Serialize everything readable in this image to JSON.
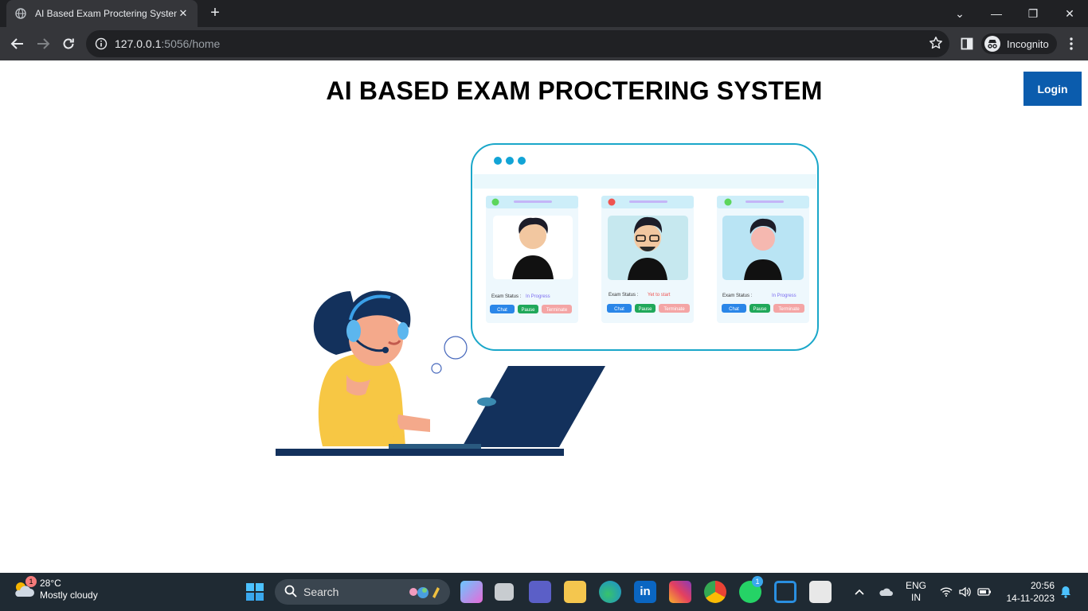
{
  "browser": {
    "tab_title": "AI Based Exam Proctering System",
    "tab_close": "✕",
    "new_tab": "+",
    "url_host": "127.0.0.1",
    "url_path": ":5056/home",
    "profile_label": "Incognito",
    "window_controls": [
      "⌄",
      "—",
      "❐",
      "✕"
    ]
  },
  "page": {
    "title": "AI BASED EXAM PROCTERING SYSTEM",
    "login_label": "Login"
  },
  "illustration": {
    "cards": [
      {
        "status_label": "Exam Status :",
        "status_value": "In Progress",
        "status_color": "#7b6cf0",
        "dot_color": "#5cd65c"
      },
      {
        "status_label": "Exam Status :",
        "status_value": "Yet to start",
        "status_color": "#ef5350",
        "dot_color": "#ef5350"
      },
      {
        "status_label": "Exam Status :",
        "status_value": "In Progress",
        "status_color": "#7b6cf0",
        "dot_color": "#5cd65c"
      }
    ],
    "buttons": [
      "Chat",
      "Pause",
      "Terminate"
    ]
  },
  "taskbar": {
    "weather_badge": "1",
    "temperature": "28°C",
    "weather_desc": "Mostly cloudy",
    "search_label": "Search",
    "lang_line1": "ENG",
    "lang_line2": "IN",
    "time": "20:56",
    "date": "14-11-2023",
    "whatsapp_badge": "1"
  },
  "colors": {
    "accent": "#0b5cad",
    "chrome_dark": "#202124",
    "chrome_mid": "#35363a",
    "taskbar": "#1f2a33"
  }
}
